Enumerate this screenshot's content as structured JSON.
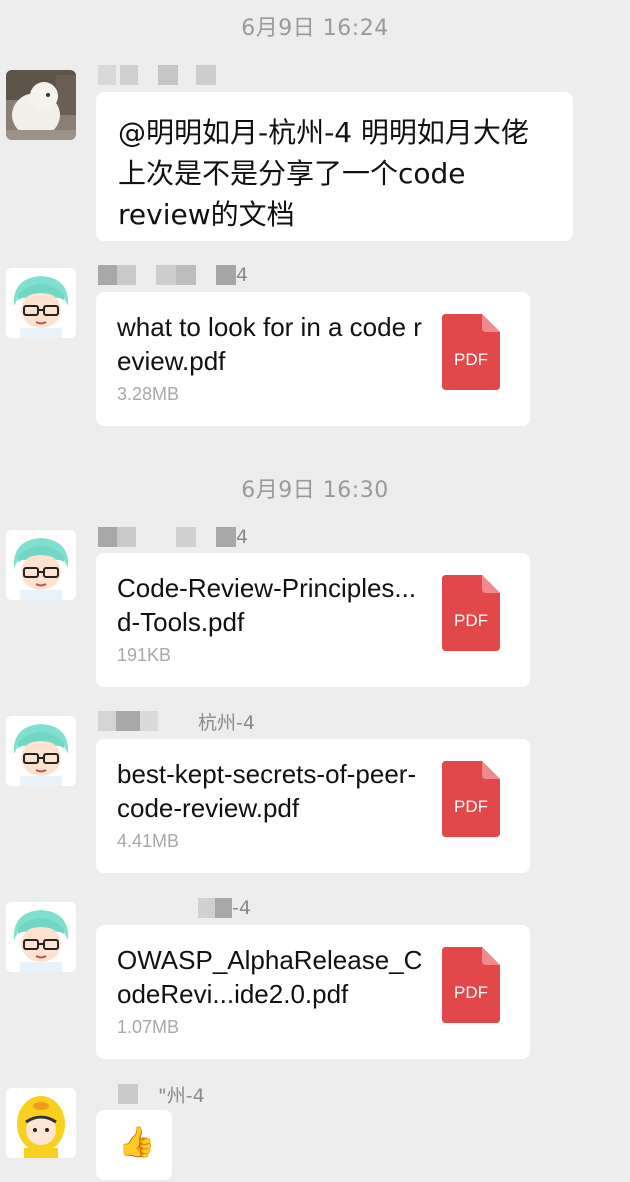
{
  "timestamps": [
    "6月9日 16:24",
    "6月9日 16:30"
  ],
  "messages": [
    {
      "sender_suffix": "",
      "text_lines": [
        "@明明如月-杭州-4 明明如月大佬",
        "上次是不是分享了一个code",
        "review的文档"
      ]
    },
    {
      "sender_suffix": "4",
      "file": {
        "name": "what to look for in a code review.pdf",
        "size": "3.28MB",
        "type": "PDF"
      }
    },
    {
      "sender_suffix": "4",
      "file": {
        "name": "Code-Review-Principles...d-Tools.pdf",
        "size": "191KB",
        "type": "PDF"
      }
    },
    {
      "sender_suffix": "杭州-4",
      "file": {
        "name": "best-kept-secrets-of-peer-code-review.pdf",
        "size": "4.41MB",
        "type": "PDF"
      }
    },
    {
      "sender_suffix": "-4",
      "file": {
        "name": "OWASP_AlphaRelease_CodeRevi...ide2.0.pdf",
        "size": "1.07MB",
        "type": "PDF"
      }
    },
    {
      "sender_suffix": "\"州-4",
      "emoji": "👍"
    }
  ],
  "colors": {
    "pdf": "#e2474a",
    "background": "#ededed",
    "bubble": "#ffffff",
    "meta": "#9a9a9a"
  },
  "icons": [
    "dog-photo-avatar",
    "cartoon-boy-glasses-avatar",
    "yellow-duck-avatar",
    "pdf-file-icon",
    "thumbs-up-emoji"
  ]
}
